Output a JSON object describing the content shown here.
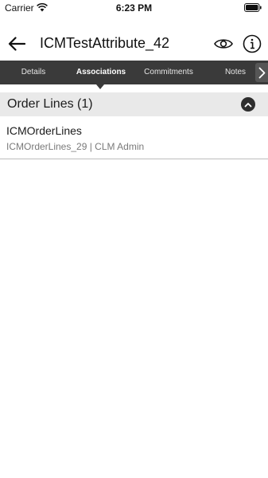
{
  "status_bar": {
    "carrier": "Carrier",
    "time": "6:23 PM",
    "wifi_icon": "wifi-icon",
    "battery_icon": "battery-icon"
  },
  "header": {
    "title": "ICMTestAttribute_42",
    "back_icon": "back-arrow-icon",
    "view_icon": "eye-icon",
    "info_icon": "info-icon"
  },
  "tabs": [
    {
      "label": "Details",
      "active": false
    },
    {
      "label": "Associations",
      "active": true
    },
    {
      "label": "Commitments",
      "active": false
    },
    {
      "label": "Notes",
      "active": false
    }
  ],
  "tabs_next_icon": "chevron-right-icon",
  "section": {
    "title": "Order Lines (1)",
    "toggle_icon": "chevron-up-icon",
    "items": [
      {
        "title": "ICMOrderLines",
        "subtitle": "ICMOrderLines_29 | CLM Admin"
      }
    ]
  },
  "colors": {
    "tab_bar": "#3a3a3a",
    "section_header": "#e9e9e9",
    "subtitle_text": "#7a7a7a"
  }
}
